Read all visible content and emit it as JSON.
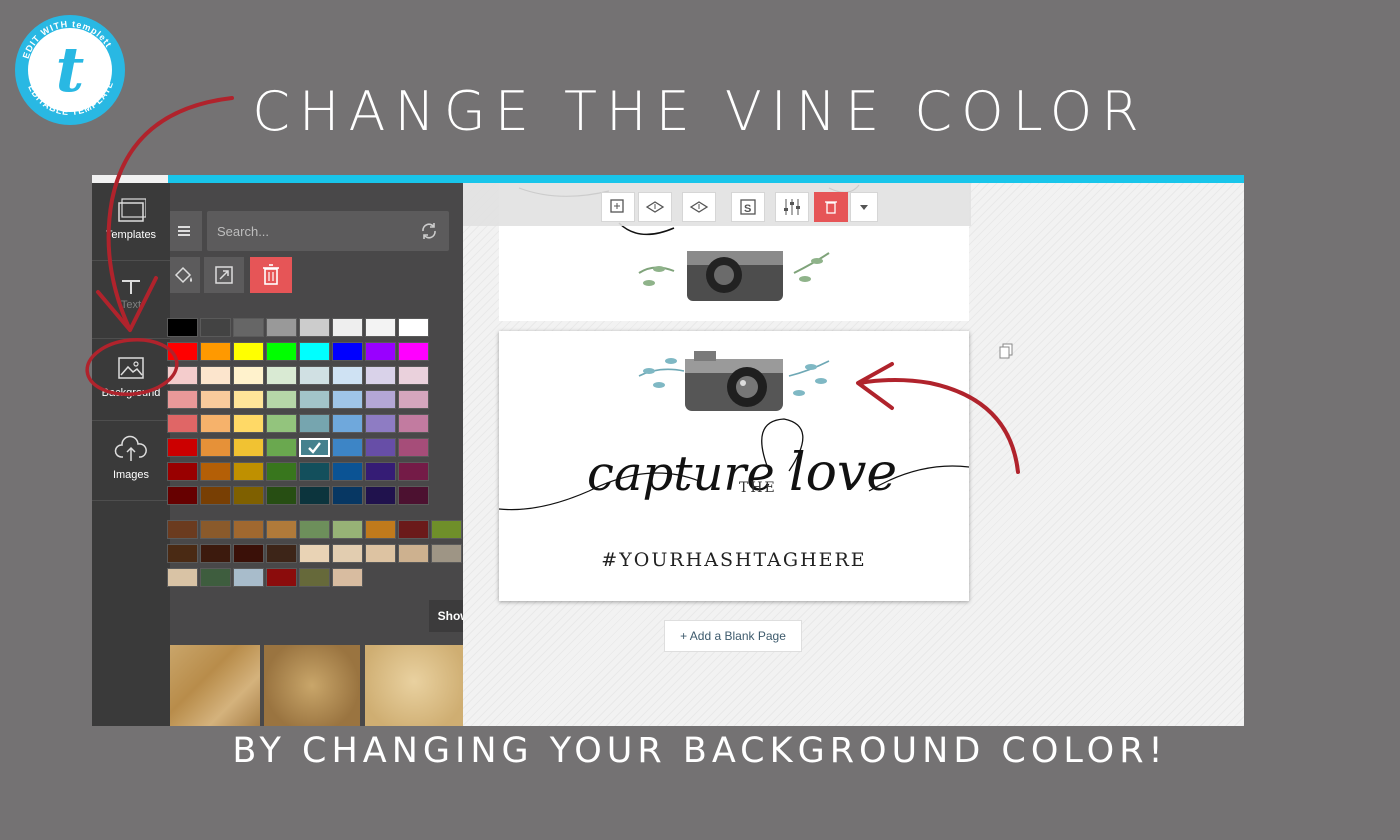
{
  "headline": "CHANGE THE VINE COLOR",
  "subline": "BY CHANGING YOUR BACKGROUND COLOR!",
  "badge": {
    "top_text": "EDIT WITH templett",
    "bottom_text": "EDITABLE TEMPLATE",
    "letter": "t"
  },
  "sidebar": {
    "items": [
      {
        "label": "Templates",
        "icon": "templates-icon"
      },
      {
        "label": "Text",
        "icon": "text-icon"
      },
      {
        "label": "Background",
        "icon": "background-icon"
      },
      {
        "label": "Images",
        "icon": "upload-cloud-icon"
      }
    ]
  },
  "panel": {
    "search_placeholder": "Search...",
    "show_advanced": "Show advanced",
    "palette_rows": [
      [
        "#000000",
        "#434343",
        "#666666",
        "#999999",
        "#cccccc",
        "#eeeeee",
        "#f3f3f3",
        "#ffffff"
      ],
      [
        "#ff0000",
        "#ff9900",
        "#ffff00",
        "#00ff00",
        "#00ffff",
        "#0000ff",
        "#9900ff",
        "#ff00ff"
      ],
      [
        "#f4cccc",
        "#fce5cd",
        "#fff2cc",
        "#d9ead3",
        "#d0e0e3",
        "#cfe2f3",
        "#d9d2e9",
        "#ead1dc"
      ],
      [
        "#ea9999",
        "#f9cb9c",
        "#ffe599",
        "#b6d7a8",
        "#a2c4c9",
        "#9fc5e8",
        "#b4a7d6",
        "#d5a6bd"
      ],
      [
        "#e06666",
        "#f6b26b",
        "#ffd966",
        "#93c47d",
        "#76a5af",
        "#6fa8dc",
        "#8e7cc3",
        "#c27ba0"
      ],
      [
        "#cc0000",
        "#e69138",
        "#f1c232",
        "#6aa84f",
        "#45818e",
        "#3d85c6",
        "#674ea7",
        "#a64d79"
      ],
      [
        "#990000",
        "#b45f06",
        "#bf9000",
        "#38761d",
        "#134f5c",
        "#0b5394",
        "#351c75",
        "#741b47"
      ],
      [
        "#660000",
        "#783f04",
        "#7f6000",
        "#274e13",
        "#0c343d",
        "#073763",
        "#20124d",
        "#4c1130"
      ]
    ],
    "selected_swatch": {
      "row": 5,
      "col": 4
    },
    "custom_rows": [
      [
        "#6b3b1f",
        "#8a5a2b",
        "#a0682f",
        "#b07a3a",
        "#6d8f5b",
        "#97b276",
        "#c07a1c",
        "#6b1a1a",
        "#6f8f2a"
      ],
      [
        "#4a2a14",
        "#3c1a0d",
        "#3a1008",
        "#3d2518",
        "#e9d3b5",
        "#e2cdb0",
        "#ddc3a2",
        "#cdb18f",
        "#9e9585"
      ],
      [
        "#d9c3a5",
        "#3e5d3e",
        "#a8bccb",
        "#8b0c0c",
        "#66693a",
        "#d8bca0"
      ]
    ]
  },
  "editor": {
    "toolbar_tools": [
      "duplicate-icon",
      "layer-up-icon",
      "layer-down-icon",
      "snap-icon",
      "adjust-icon",
      "trash-icon",
      "chevron-down-icon"
    ],
    "hashtag": "#YOURHASHTAGHERE",
    "title_script_1": "capture",
    "title_small": "THE",
    "title_script_2": "love",
    "add_page": "+ Add a Blank Page"
  }
}
